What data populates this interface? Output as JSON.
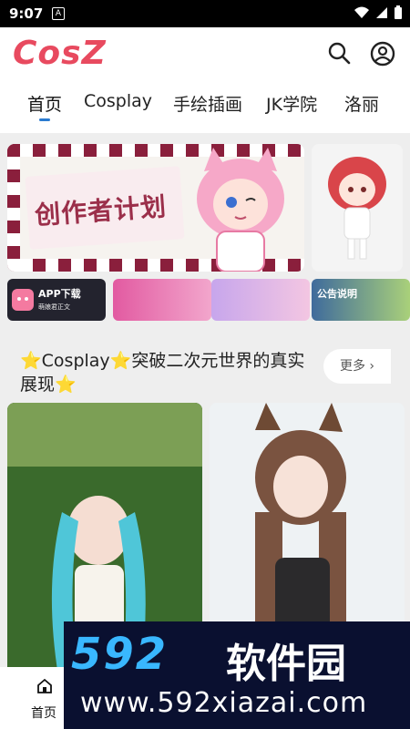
{
  "status": {
    "time": "9:07",
    "notification": "A"
  },
  "app": {
    "logo": "CosZ",
    "brand_color": "#e84a5f",
    "accent_color": "#2a7bd0"
  },
  "tabs": [
    {
      "label": "首页",
      "active": true
    },
    {
      "label": "Cosplay"
    },
    {
      "label": "手绘插画"
    },
    {
      "label": "JK学院"
    },
    {
      "label": "洛丽"
    }
  ],
  "banner": {
    "title": "创作者计划"
  },
  "thumbs": [
    {
      "label": "APP下载",
      "sub": "萌娘君正文"
    },
    {
      "label": ""
    },
    {
      "label": ""
    },
    {
      "label": "公告说明"
    }
  ],
  "section": {
    "title": "⭐Cosplay⭐突破二次元世界的真实展现⭐",
    "more": "更多 ›"
  },
  "bottom_nav": {
    "home_label": "首页"
  },
  "watermark": {
    "numbers": "592",
    "name": "软件园",
    "url": "www.592xiazai.com"
  }
}
